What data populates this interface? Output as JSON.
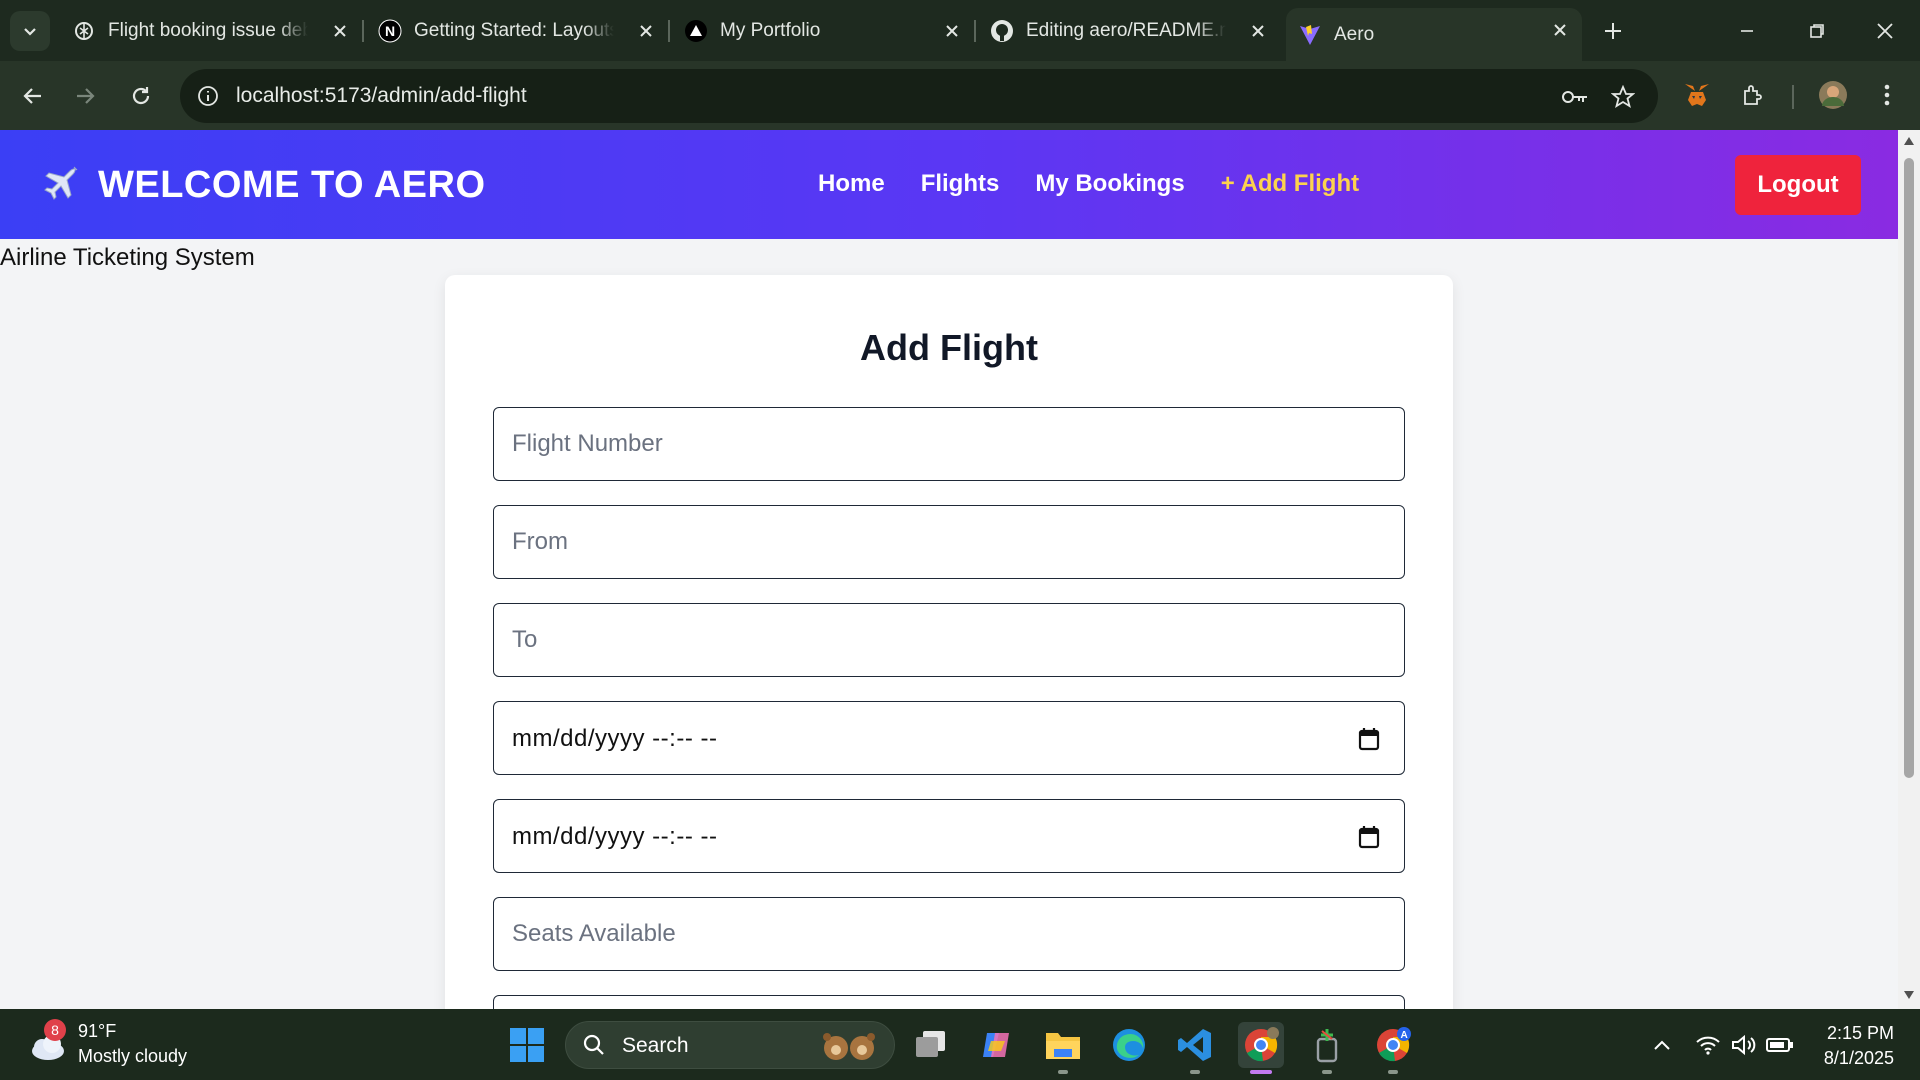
{
  "browser": {
    "tabs": [
      {
        "title": "Flight booking issue debu",
        "icon": "chatgpt-icon"
      },
      {
        "title": "Getting Started: Layouts a",
        "icon": "nextjs-icon"
      },
      {
        "title": "My Portfolio",
        "icon": "vercel-icon"
      },
      {
        "title": "Editing aero/README.md",
        "icon": "github-icon"
      },
      {
        "title": "Aero",
        "icon": "vite-icon",
        "active": true
      }
    ],
    "url": "localhost:5173/admin/add-flight"
  },
  "app": {
    "brand": "WELCOME TO AERO",
    "nav": [
      {
        "label": "Home"
      },
      {
        "label": "Flights"
      },
      {
        "label": "My Bookings"
      },
      {
        "label": "+ Add Flight",
        "active": true
      }
    ],
    "logout_label": "Logout",
    "subtitle": "Airline Ticketing System",
    "colors": {
      "nav_start": "#3b3ff5",
      "nav_end": "#8a2be2",
      "logout": "#ef233c",
      "active_link": "#fcd34d"
    }
  },
  "form": {
    "title": "Add Flight",
    "flight_number_placeholder": "Flight Number",
    "from_placeholder": "From",
    "to_placeholder": "To",
    "departure_value": "mm/dd/yyyy --:-- --",
    "arrival_value": "mm/dd/yyyy --:-- --",
    "seats_placeholder": "Seats Available"
  },
  "taskbar": {
    "weather_temp": "91°F",
    "weather_desc": "Mostly cloudy",
    "weather_badge": "8",
    "search_label": "Search",
    "time": "2:15 PM",
    "date": "8/1/2025"
  }
}
